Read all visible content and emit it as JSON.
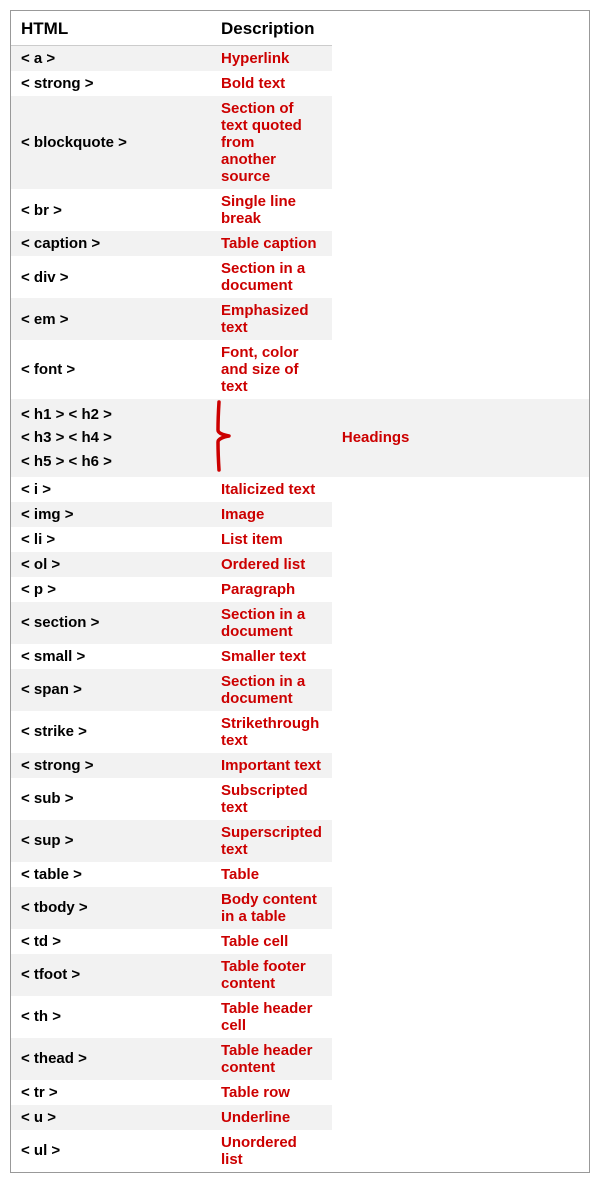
{
  "header": {
    "col_html": "HTML",
    "col_desc": "Description"
  },
  "rows": [
    {
      "html": "< a >",
      "desc": "Hyperlink",
      "type": "normal"
    },
    {
      "html": "< strong >",
      "desc": "Bold text",
      "type": "normal"
    },
    {
      "html": "< blockquote >",
      "desc": "Section of text quoted from another source",
      "type": "multiline"
    },
    {
      "html": "< br >",
      "desc": "Single line break",
      "type": "normal"
    },
    {
      "html": "< caption >",
      "desc": "Table caption",
      "type": "normal"
    },
    {
      "html": "< div >",
      "desc": "Section in a document",
      "type": "normal"
    },
    {
      "html": "< em >",
      "desc": "Emphasized text",
      "type": "normal"
    },
    {
      "html": "< font >",
      "desc": "Font, color and size of text",
      "type": "normal"
    },
    {
      "html": "headings_group",
      "desc": "Headings",
      "type": "headings"
    },
    {
      "html": "< i >",
      "desc": "Italicized text",
      "type": "normal"
    },
    {
      "html": "< img >",
      "desc": "Image",
      "type": "normal"
    },
    {
      "html": "< li >",
      "desc": "List item",
      "type": "normal"
    },
    {
      "html": "< ol >",
      "desc": "Ordered list",
      "type": "normal"
    },
    {
      "html": "< p >",
      "desc": "Paragraph",
      "type": "normal"
    },
    {
      "html": "< section >",
      "desc": "Section in a document",
      "type": "normal"
    },
    {
      "html": "< small >",
      "desc": "Smaller text",
      "type": "normal"
    },
    {
      "html": "< span >",
      "desc": "Section in a document",
      "type": "normal"
    },
    {
      "html": "< strike >",
      "desc": "Strikethrough text",
      "type": "normal"
    },
    {
      "html": "< strong >",
      "desc": "Important text",
      "type": "normal"
    },
    {
      "html": "< sub >",
      "desc": "Subscripted text",
      "type": "normal"
    },
    {
      "html": "< sup >",
      "desc": "Superscripted text",
      "type": "normal"
    },
    {
      "html": "< table >",
      "desc": "Table",
      "type": "normal"
    },
    {
      "html": "< tbody >",
      "desc": "Body content in a table",
      "type": "normal"
    },
    {
      "html": "< td >",
      "desc": "Table cell",
      "type": "normal"
    },
    {
      "html": "< tfoot >",
      "desc": "Table footer content",
      "type": "normal"
    },
    {
      "html": "< th >",
      "desc": "Table header cell",
      "type": "normal"
    },
    {
      "html": "< thead >",
      "desc": "Table header content",
      "type": "normal"
    },
    {
      "html": "< tr >",
      "desc": "Table row",
      "type": "normal"
    },
    {
      "html": "< u >",
      "desc": "Underline",
      "type": "normal"
    },
    {
      "html": "< ul >",
      "desc": "Unordered list",
      "type": "normal"
    }
  ],
  "headings_lines": [
    "< h1 > < h2 >",
    "< h3 > < h4 >",
    "< h5 > < h6 >"
  ],
  "colors": {
    "desc_text": "#cc0000",
    "html_text": "#000000",
    "brace_color": "#cc0000"
  }
}
